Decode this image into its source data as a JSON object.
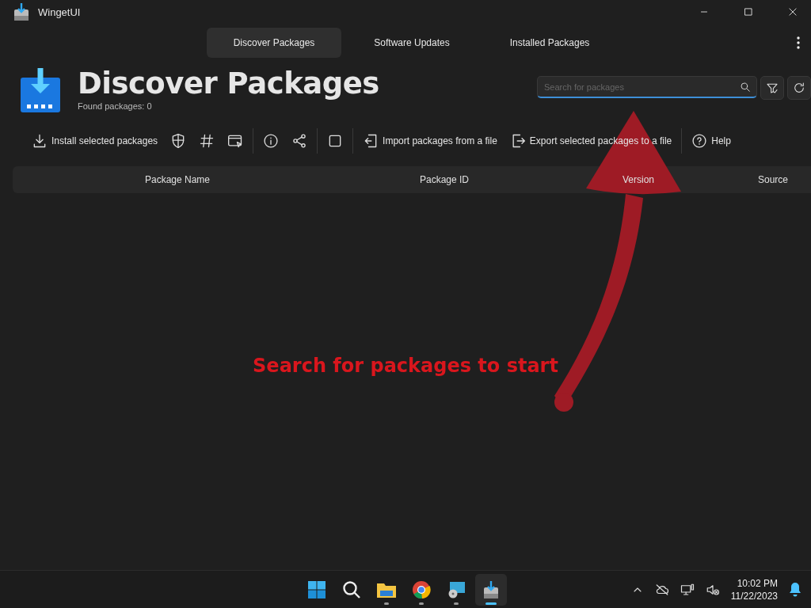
{
  "window": {
    "title": "WingetUI"
  },
  "tabs": [
    {
      "label": "Discover Packages",
      "selected": true
    },
    {
      "label": "Software Updates",
      "selected": false
    },
    {
      "label": "Installed Packages",
      "selected": false
    }
  ],
  "header": {
    "title": "Discover Packages",
    "subtitle": "Found packages: 0"
  },
  "search": {
    "placeholder": "Search for packages"
  },
  "toolbar": [
    {
      "kind": "install",
      "label": "Install selected packages"
    },
    {
      "kind": "shield"
    },
    {
      "kind": "hash"
    },
    {
      "kind": "window"
    },
    {
      "kind": "separator"
    },
    {
      "kind": "info"
    },
    {
      "kind": "share"
    },
    {
      "kind": "separator"
    },
    {
      "kind": "select"
    },
    {
      "kind": "separator"
    },
    {
      "kind": "import",
      "label": "Import packages from a file"
    },
    {
      "kind": "export",
      "label": "Export selected packages to a file"
    },
    {
      "kind": "separator"
    },
    {
      "kind": "help",
      "label": "Help"
    }
  ],
  "table": {
    "columns": [
      "Package Name",
      "Package ID",
      "Version",
      "Source"
    ]
  },
  "message": "Search for packages to start",
  "taskbar": {
    "apps": [
      {
        "kind": "start",
        "running": false,
        "selected": false
      },
      {
        "kind": "search",
        "running": false,
        "selected": false
      },
      {
        "kind": "files",
        "running": true,
        "selected": false
      },
      {
        "kind": "browser",
        "running": true,
        "selected": false
      },
      {
        "kind": "monitor",
        "running": true,
        "selected": false
      },
      {
        "kind": "wingetui",
        "running": true,
        "selected": true
      }
    ],
    "time": "10:02 PM",
    "date": "11/22/2023"
  }
}
